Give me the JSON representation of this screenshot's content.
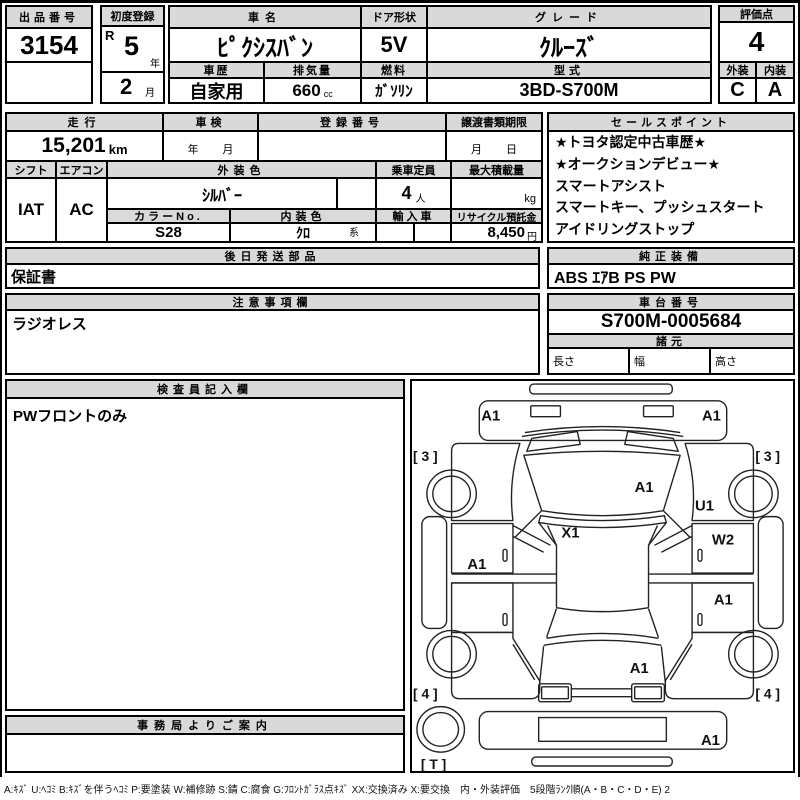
{
  "top": {
    "auction_no_label": "出品番号",
    "auction_no": "3154",
    "first_reg_label": "初度登録",
    "era": "R",
    "reg_year": "5",
    "year_unit": "年",
    "reg_month": "2",
    "month_unit": "月",
    "car_name_label": "車名",
    "car_name": "ﾋﾟｸｼｽﾊﾞﾝ",
    "history_label": "車歴",
    "history": "自家用",
    "displacement_label": "排気量",
    "displacement": "660",
    "displacement_unit": "cc",
    "door_label": "ドア形状",
    "door": "5V",
    "fuel_label": "燃料",
    "fuel": "ｶﾞｿﾘﾝ",
    "grade_label": "グレード",
    "grade": "ｸﾙｰｽﾞ",
    "model_label": "型式",
    "model": "3BD-S700M",
    "score_label": "評価点",
    "score": "4",
    "exterior_label": "外装",
    "exterior": "C",
    "interior_label": "内装",
    "interior": "A"
  },
  "mid": {
    "mileage_label": "走行",
    "mileage": "15,201",
    "mileage_unit": "km",
    "shaken_label": "車検",
    "shaken_year": "年",
    "shaken_month": "月",
    "reg_no_label": "登録番号",
    "reg_no": "",
    "transfer_label": "譲渡書類期限",
    "transfer_month": "月",
    "transfer_day": "日",
    "shift_label": "シフト",
    "shift": "IAT",
    "aircon_label": "エアコン",
    "aircon": "AC",
    "ext_color_label": "外装色",
    "ext_color": "ｼﾙﾊﾞｰ",
    "color_no_label": "カラーNo.",
    "color_no": "S28",
    "int_color_label": "内装色",
    "int_color": "ｸﾛ",
    "int_color_suffix": "系",
    "capacity_label": "乗車定員",
    "capacity": "4",
    "capacity_unit": "人",
    "max_load_label": "最大積載量",
    "max_load_unit": "kg",
    "import_label": "輸入車",
    "recycle_label": "リサイクル預託金",
    "recycle": "8,450",
    "recycle_unit": "円"
  },
  "sales": {
    "title": "セールスポイント",
    "items": [
      "★トヨタ認定中古車歴★",
      "★オークションデビュー★",
      "スマートアシスト",
      "スマートキー、プッシュスタート",
      "アイドリングストップ"
    ]
  },
  "parts": {
    "title": "後日発送部品",
    "value": "保証書"
  },
  "equip": {
    "title": "純正装備",
    "value": "ABS ｴｱB PS PW"
  },
  "notes": {
    "title": "注意事項欄",
    "value": "ラジオレス"
  },
  "chassis": {
    "title": "車台番号",
    "value": "S700M-0005684"
  },
  "specs": {
    "title": "諸元",
    "length_label": "長さ",
    "width_label": "幅",
    "height_label": "高さ"
  },
  "inspector": {
    "title": "検査員記入欄",
    "value": "PWフロントのみ"
  },
  "office": {
    "title": "事務局よりご案内"
  },
  "diagram": {
    "labels": [
      "A1",
      "A1",
      "[ 3 ]",
      "[ 3 ]",
      "A1",
      "U1",
      "X1",
      "W2",
      "A1",
      "A1",
      "A1",
      "[ 4 ]",
      "[ 4 ]",
      "A1",
      "[ T ]"
    ]
  },
  "legend": "A:ｷｽﾞ U:ﾍｺﾐ B:ｷｽﾞを伴うﾍｺﾐ P:要塗装 W:補修跡 S:錆 C:腐食 G:ﾌﾛﾝﾄｶﾞﾗｽ点ｷｽﾞ XX:交換済み X:要交換　内・外装評価　5段階ﾗﾝｸ順(A・B・C・D・E) 2"
}
